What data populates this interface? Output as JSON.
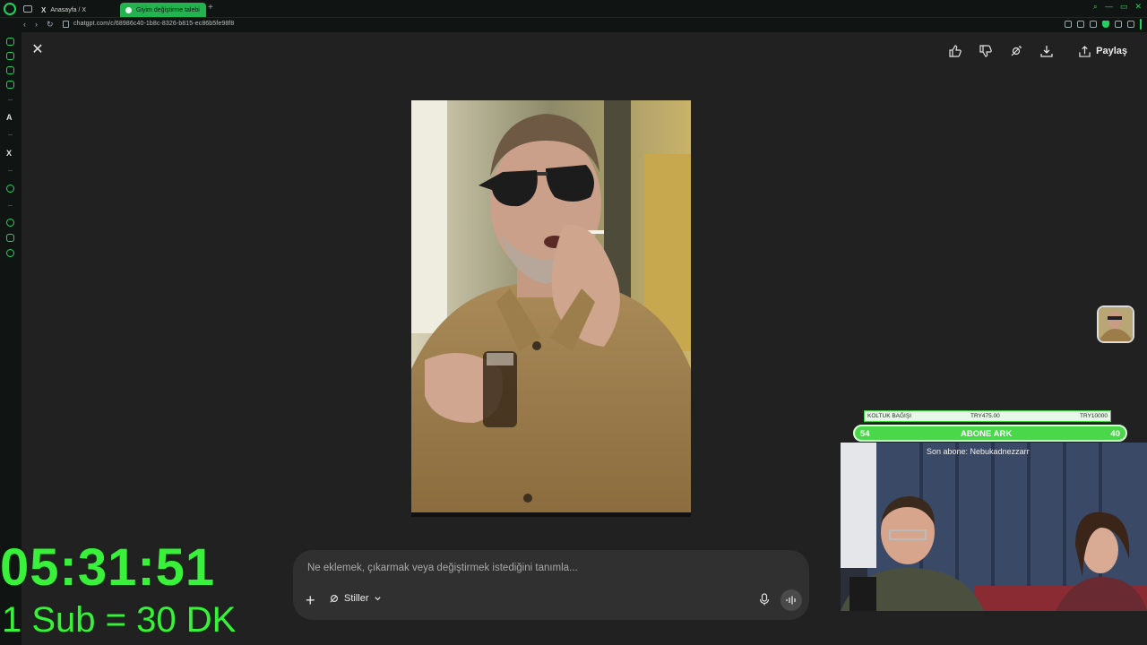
{
  "browser": {
    "tabs": [
      {
        "label": "Anasayfa / X"
      },
      {
        "label": "Giyim değiştirme talebi"
      }
    ],
    "url": "chatgpt.com/c/68986c40-1b8c-8326-b815-ec86b5fe98f8"
  },
  "toolbar": {
    "share_label": "Paylaş"
  },
  "composer": {
    "placeholder": "Ne eklemek, çıkarmak veya değiştirmek istediğini tanımla...",
    "styles_label": "Stiller"
  },
  "overlay": {
    "timer": "05:31:51",
    "sub_info": "1 Sub = 30 DK",
    "donation_title": "KOLTUK BAĞIŞI",
    "donation_current": "TRY475.00",
    "donation_goal": "TRY10000",
    "sub_goal_left": "54",
    "sub_goal_label": "ABONE ARK",
    "sub_goal_right": "40",
    "last_sub": "Son abone: Nebukadnezzarr"
  },
  "colors": {
    "accent_green": "#39f03a",
    "app_bg": "#212121",
    "composer_bg": "#303030"
  }
}
